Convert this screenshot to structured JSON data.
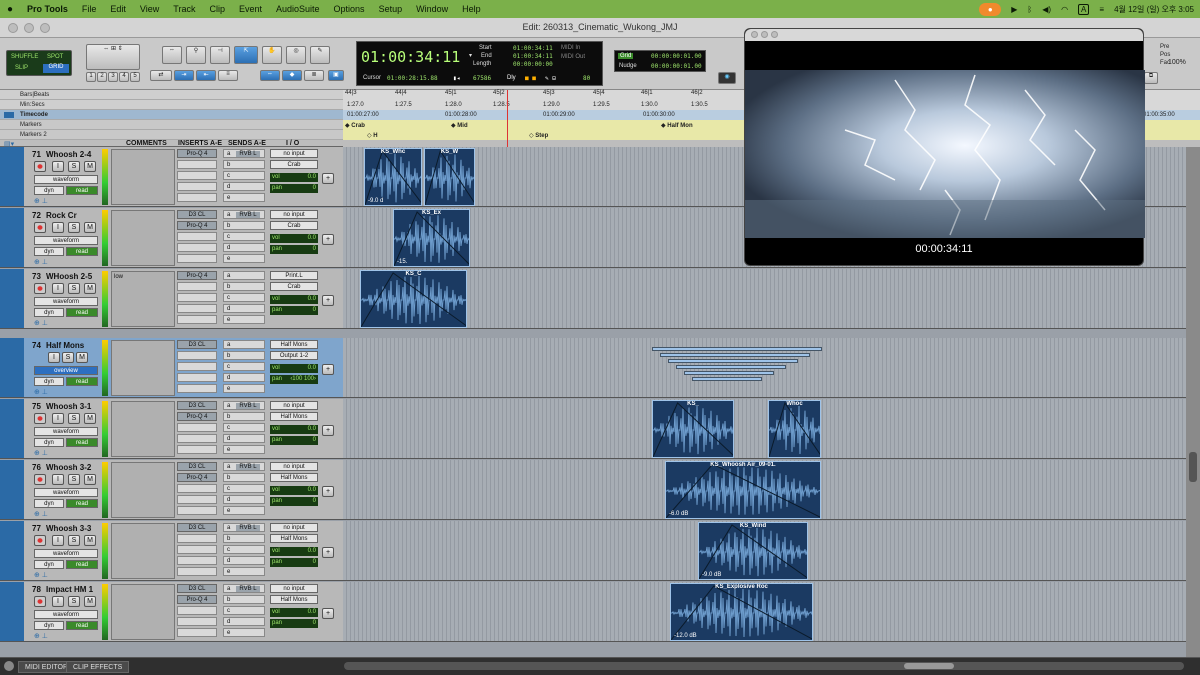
{
  "menubar": {
    "apple": "",
    "app": "Pro Tools",
    "items": [
      "File",
      "Edit",
      "View",
      "Track",
      "Clip",
      "Event",
      "AudioSuite",
      "Options",
      "Setup",
      "Window",
      "Help"
    ],
    "datetime": "4월 12일 (일) 오후 3:05",
    "input_badge": "A"
  },
  "window": {
    "title": "Edit: 260313_Cinematic_Wukong_JMJ"
  },
  "toolbar": {
    "modes": [
      "SHUFFLE",
      "SPOT",
      "SLIP",
      "GRID"
    ],
    "zoom_presets": [
      "1",
      "2",
      "3",
      "4",
      "5"
    ],
    "main_counter": "01:00:34:11",
    "start_label": "Start",
    "end_label": "End",
    "length_label": "Length",
    "start": "01:00:34:11",
    "end": "01:00:34:11",
    "length": "00:00:00:00",
    "cursor_label": "Cursor",
    "cursor": "01:00:28:15.88",
    "samples": "67586",
    "dly_label": "Dly",
    "midi_in": "MIDI In",
    "midi_out": "MIDI Out",
    "value_80": "80",
    "grid_label": "Grid",
    "grid_value": "00:00:00:01.00",
    "nudge_label": "Nudge",
    "nudge_value": "00:00:00:01.00",
    "pre": "Pre",
    "post": "Pos",
    "fac": "Fac",
    "zoom_pct": "100%"
  },
  "rulers": {
    "labels": [
      "Bars|Beats",
      "Min:Secs",
      "Timecode",
      "Markers",
      "Markers 2"
    ],
    "bars": [
      "44|3",
      "44|4",
      "45|1",
      "45|2",
      "45|3",
      "45|4",
      "46|1",
      "46|2"
    ],
    "mins": [
      "1:27.0",
      "1:27.5",
      "1:28.0",
      "1:28.5",
      "1:29.0",
      "1:29.5",
      "1:30.0",
      "1:30.5"
    ],
    "timecodes": [
      "01:00:27:00",
      "01:00:28:00",
      "01:00:29:00",
      "01:00:30:00",
      "01:00:35:00"
    ],
    "markers": [
      "Crab",
      "Mid",
      "Half Mon"
    ],
    "markers2": [
      "H",
      "Step"
    ]
  },
  "columns": {
    "comments": "COMMENTS",
    "inserts": "INSERTS A-E",
    "sends": "SENDS A-E",
    "io": "I / O"
  },
  "tracks": [
    {
      "num": "71",
      "name": "Whoosh 2-4",
      "view": "waveform",
      "inserts": [
        "Pro-Q 4"
      ],
      "send": "RVB L",
      "input": "no input",
      "output": "Crab",
      "vol": "0.0",
      "pan": "0",
      "comment": ""
    },
    {
      "num": "72",
      "name": "Rock Cr",
      "view": "waveform",
      "inserts": [
        "D3 CL",
        "Pro-Q 4"
      ],
      "send": "RVB L",
      "input": "no input",
      "output": "Crab",
      "vol": "0.0",
      "pan": "0",
      "comment": ""
    },
    {
      "num": "73",
      "name": "WHoosh 2-5",
      "view": "waveform",
      "inserts": [
        "Pro-Q 4"
      ],
      "send": "",
      "input": "Print.L",
      "output": "Crab",
      "vol": "0.0",
      "pan": "0",
      "comment": "low"
    },
    {
      "num": "74",
      "name": "Half Mons",
      "view": "overview",
      "inserts": [
        "D3 CL"
      ],
      "send": "",
      "input": "Half Mons",
      "output": "Output 1-2",
      "vol": "0.0",
      "pan": "‹100  100›",
      "comment": ""
    },
    {
      "num": "75",
      "name": "Whoosh 3-1",
      "view": "waveform",
      "inserts": [
        "D3 CL",
        "Pro-Q 4"
      ],
      "send": "RVB L",
      "input": "no input",
      "output": "Half Mons",
      "vol": "0.0",
      "pan": "0",
      "comment": ""
    },
    {
      "num": "76",
      "name": "Whoosh 3-2",
      "view": "waveform",
      "inserts": [
        "D3 CL",
        "Pro-Q 4"
      ],
      "send": "RVB L",
      "input": "no input",
      "output": "Half Mons",
      "vol": "0.0",
      "pan": "0",
      "comment": ""
    },
    {
      "num": "77",
      "name": "Whoosh 3-3",
      "view": "waveform",
      "inserts": [
        "D3 CL"
      ],
      "send": "RVB L",
      "input": "no input",
      "output": "Half Mons",
      "vol": "0.0",
      "pan": "0",
      "comment": ""
    },
    {
      "num": "78",
      "name": "Impact HM 1",
      "view": "waveform",
      "inserts": [
        "D3 CL",
        "Pro-Q 4"
      ],
      "send": "RVB L",
      "input": "no input",
      "output": "Half Mons",
      "vol": "0.0",
      "pan": "0",
      "comment": ""
    }
  ],
  "track_labels": {
    "dyn": "dyn",
    "read": "read",
    "vol": "vol",
    "pan": "pan",
    "send_slots": [
      "a",
      "b",
      "c",
      "d",
      "e"
    ],
    "btn_i": "I",
    "btn_s": "S",
    "btn_m": "M"
  },
  "clips": [
    {
      "name": "KS_Whc",
      "gain": "-9.0 d"
    },
    {
      "name": "KS_W",
      "gain": ""
    },
    {
      "name": "KS_Ex",
      "gain": "-15."
    },
    {
      "name": "KS_C",
      "gain": ""
    },
    {
      "name": "KS_",
      "gain": ""
    },
    {
      "name": "Whoc",
      "gain": ""
    },
    {
      "name": "KS_Whoosh Air_09-01.",
      "gain": "-6.0 dB"
    },
    {
      "name": "KS_Wind",
      "gain": "-9.0 dB"
    },
    {
      "name": "KS_Explosive Roc",
      "gain": "-12.0 dB"
    }
  ],
  "video": {
    "timecode": "00:00:34:11"
  },
  "bottom": {
    "tabs": [
      "MIDI EDITOR",
      "CLIP EFFECTS"
    ]
  },
  "colors": {
    "menubar": "#7bb04a",
    "track_stripe": "#2b6aa6",
    "clip": "#1b3a62",
    "lcd_text": "#b8ff7a"
  }
}
